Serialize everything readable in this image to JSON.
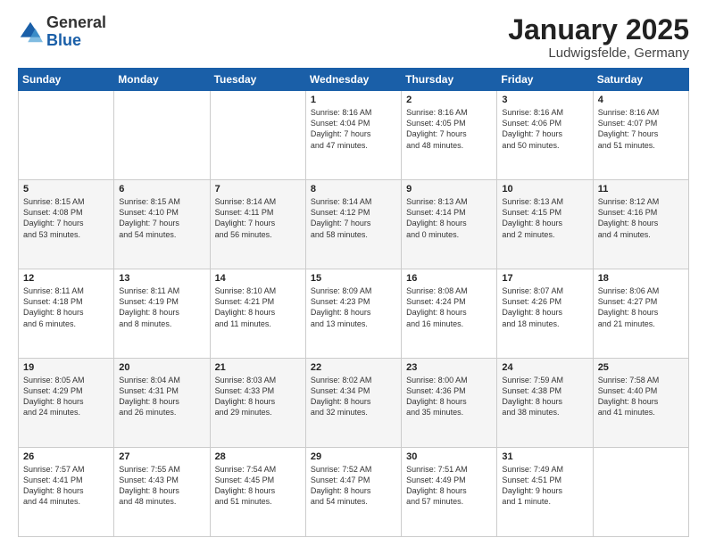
{
  "logo": {
    "general": "General",
    "blue": "Blue"
  },
  "title": "January 2025",
  "location": "Ludwigsfelde, Germany",
  "days_header": [
    "Sunday",
    "Monday",
    "Tuesday",
    "Wednesday",
    "Thursday",
    "Friday",
    "Saturday"
  ],
  "weeks": [
    [
      {
        "day": "",
        "info": ""
      },
      {
        "day": "",
        "info": ""
      },
      {
        "day": "",
        "info": ""
      },
      {
        "day": "1",
        "info": "Sunrise: 8:16 AM\nSunset: 4:04 PM\nDaylight: 7 hours\nand 47 minutes."
      },
      {
        "day": "2",
        "info": "Sunrise: 8:16 AM\nSunset: 4:05 PM\nDaylight: 7 hours\nand 48 minutes."
      },
      {
        "day": "3",
        "info": "Sunrise: 8:16 AM\nSunset: 4:06 PM\nDaylight: 7 hours\nand 50 minutes."
      },
      {
        "day": "4",
        "info": "Sunrise: 8:16 AM\nSunset: 4:07 PM\nDaylight: 7 hours\nand 51 minutes."
      }
    ],
    [
      {
        "day": "5",
        "info": "Sunrise: 8:15 AM\nSunset: 4:08 PM\nDaylight: 7 hours\nand 53 minutes."
      },
      {
        "day": "6",
        "info": "Sunrise: 8:15 AM\nSunset: 4:10 PM\nDaylight: 7 hours\nand 54 minutes."
      },
      {
        "day": "7",
        "info": "Sunrise: 8:14 AM\nSunset: 4:11 PM\nDaylight: 7 hours\nand 56 minutes."
      },
      {
        "day": "8",
        "info": "Sunrise: 8:14 AM\nSunset: 4:12 PM\nDaylight: 7 hours\nand 58 minutes."
      },
      {
        "day": "9",
        "info": "Sunrise: 8:13 AM\nSunset: 4:14 PM\nDaylight: 8 hours\nand 0 minutes."
      },
      {
        "day": "10",
        "info": "Sunrise: 8:13 AM\nSunset: 4:15 PM\nDaylight: 8 hours\nand 2 minutes."
      },
      {
        "day": "11",
        "info": "Sunrise: 8:12 AM\nSunset: 4:16 PM\nDaylight: 8 hours\nand 4 minutes."
      }
    ],
    [
      {
        "day": "12",
        "info": "Sunrise: 8:11 AM\nSunset: 4:18 PM\nDaylight: 8 hours\nand 6 minutes."
      },
      {
        "day": "13",
        "info": "Sunrise: 8:11 AM\nSunset: 4:19 PM\nDaylight: 8 hours\nand 8 minutes."
      },
      {
        "day": "14",
        "info": "Sunrise: 8:10 AM\nSunset: 4:21 PM\nDaylight: 8 hours\nand 11 minutes."
      },
      {
        "day": "15",
        "info": "Sunrise: 8:09 AM\nSunset: 4:23 PM\nDaylight: 8 hours\nand 13 minutes."
      },
      {
        "day": "16",
        "info": "Sunrise: 8:08 AM\nSunset: 4:24 PM\nDaylight: 8 hours\nand 16 minutes."
      },
      {
        "day": "17",
        "info": "Sunrise: 8:07 AM\nSunset: 4:26 PM\nDaylight: 8 hours\nand 18 minutes."
      },
      {
        "day": "18",
        "info": "Sunrise: 8:06 AM\nSunset: 4:27 PM\nDaylight: 8 hours\nand 21 minutes."
      }
    ],
    [
      {
        "day": "19",
        "info": "Sunrise: 8:05 AM\nSunset: 4:29 PM\nDaylight: 8 hours\nand 24 minutes."
      },
      {
        "day": "20",
        "info": "Sunrise: 8:04 AM\nSunset: 4:31 PM\nDaylight: 8 hours\nand 26 minutes."
      },
      {
        "day": "21",
        "info": "Sunrise: 8:03 AM\nSunset: 4:33 PM\nDaylight: 8 hours\nand 29 minutes."
      },
      {
        "day": "22",
        "info": "Sunrise: 8:02 AM\nSunset: 4:34 PM\nDaylight: 8 hours\nand 32 minutes."
      },
      {
        "day": "23",
        "info": "Sunrise: 8:00 AM\nSunset: 4:36 PM\nDaylight: 8 hours\nand 35 minutes."
      },
      {
        "day": "24",
        "info": "Sunrise: 7:59 AM\nSunset: 4:38 PM\nDaylight: 8 hours\nand 38 minutes."
      },
      {
        "day": "25",
        "info": "Sunrise: 7:58 AM\nSunset: 4:40 PM\nDaylight: 8 hours\nand 41 minutes."
      }
    ],
    [
      {
        "day": "26",
        "info": "Sunrise: 7:57 AM\nSunset: 4:41 PM\nDaylight: 8 hours\nand 44 minutes."
      },
      {
        "day": "27",
        "info": "Sunrise: 7:55 AM\nSunset: 4:43 PM\nDaylight: 8 hours\nand 48 minutes."
      },
      {
        "day": "28",
        "info": "Sunrise: 7:54 AM\nSunset: 4:45 PM\nDaylight: 8 hours\nand 51 minutes."
      },
      {
        "day": "29",
        "info": "Sunrise: 7:52 AM\nSunset: 4:47 PM\nDaylight: 8 hours\nand 54 minutes."
      },
      {
        "day": "30",
        "info": "Sunrise: 7:51 AM\nSunset: 4:49 PM\nDaylight: 8 hours\nand 57 minutes."
      },
      {
        "day": "31",
        "info": "Sunrise: 7:49 AM\nSunset: 4:51 PM\nDaylight: 9 hours\nand 1 minute."
      },
      {
        "day": "",
        "info": ""
      }
    ]
  ]
}
